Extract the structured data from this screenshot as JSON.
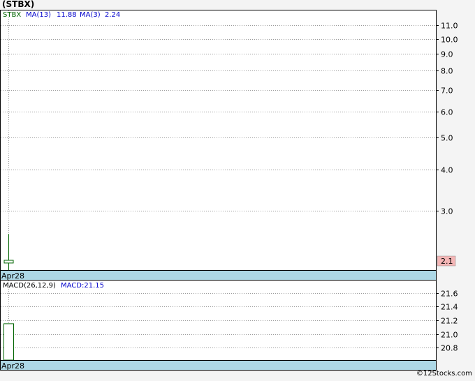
{
  "header": {
    "title": "(STBX)"
  },
  "footer": {
    "copyright": "©12Stocks.com"
  },
  "chart_data": [
    {
      "type": "candlestick",
      "panel": "price",
      "legend": {
        "ticker": "STBX",
        "ma13_label": "MA(13)",
        "ma13_value": "11.88",
        "ma3_label": "MA(3)",
        "ma3_value": "2.24"
      },
      "x": [
        "Apr28"
      ],
      "candles": [
        {
          "date": "Apr28",
          "open": 2.08,
          "close": 2.12,
          "high": 2.55,
          "low": 1.98
        }
      ],
      "y_scale": "log",
      "y_ticks": [
        "11.0",
        "10.0",
        "9.0",
        "8.0",
        "7.0",
        "6.0",
        "5.0",
        "4.0",
        "3.0"
      ],
      "last_price_label": "2.1",
      "last_price": 2.1,
      "ylim": [
        1.98,
        12.2
      ],
      "x_label": "Apr28",
      "colors": {
        "candle": "#006400",
        "ticker": "#006400",
        "ma": "#0000cc",
        "last_price_bg": "#f4b6b6"
      },
      "grid": true
    },
    {
      "type": "bar",
      "panel": "macd",
      "legend": {
        "label": "MACD(26,12,9)",
        "value_label": "MACD:21.15"
      },
      "x": [
        "Apr28"
      ],
      "values": [
        21.15
      ],
      "y_ticks": [
        "21.6",
        "21.4",
        "21.2",
        "21.0",
        "20.8"
      ],
      "ylim": [
        20.62,
        21.78
      ],
      "x_label": "Apr28",
      "colors": {
        "bar": "#006400",
        "macd_text": "#0000cc"
      },
      "grid": true
    }
  ]
}
